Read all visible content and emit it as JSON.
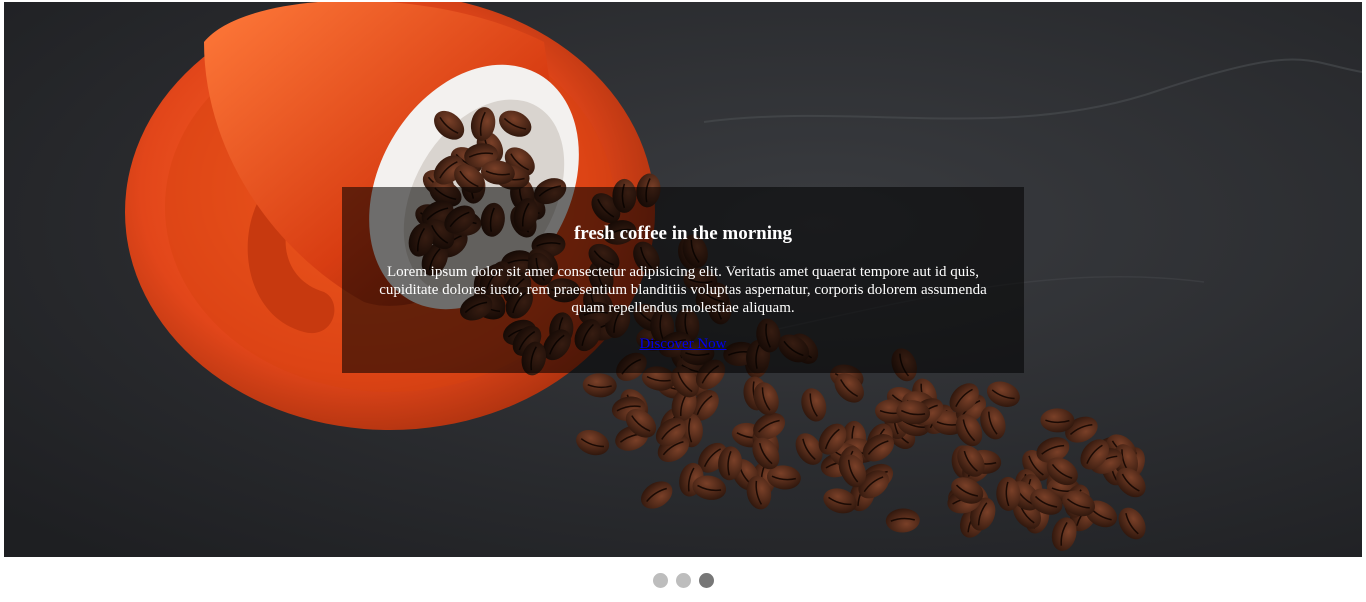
{
  "slide": {
    "title": "fresh coffee in the morning",
    "text": "Lorem ipsum dolor sit amet consectetur adipisicing elit. Veritatis amet quaerat tempore aut id quis, cupiditate dolores iusto, rem praesentium blanditiis voluptas aspernatur, corporis dolorem assumenda quam repellendus molestiae aliquam.",
    "link_label": "Discover Now"
  },
  "pagination": {
    "count": 3,
    "active_index": 2
  },
  "colors": {
    "background": "#2b2d30",
    "cup": "#e2461a",
    "bean": "#4a2516",
    "link": "#0000ee",
    "dot": "#bdbdbd",
    "dot_active": "#777777"
  }
}
